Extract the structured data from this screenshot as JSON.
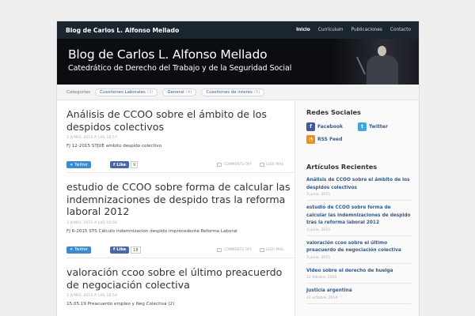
{
  "topnav": {
    "site_title": "Blog de Carlos L. Alfonso Mellado",
    "menu": [
      "Inicio",
      "Currículum",
      "Publicaciones",
      "Contacto"
    ]
  },
  "header": {
    "title": "Blog de Carlos L. Alfonso Mellado",
    "subtitle": "Catedrático de Derecho del Trabajo y de la Seguridad Social"
  },
  "categories": {
    "label": "Categorías",
    "items": [
      {
        "name": "Cuestiones Laborales",
        "count": "(3)"
      },
      {
        "name": "General",
        "count": "(4)"
      },
      {
        "name": "Cuestiones de interés",
        "count": "(5)"
      }
    ]
  },
  "posts": [
    {
      "title": "Análisis de CCOO sobre el ámbito de los despidos colectivos",
      "date": "3 JUNIO, 2015 A LAS 16:57",
      "excerpt": "FJ 12-2015 STJUE ambito despido colectivo",
      "twitter": "Twitter",
      "like": "Like",
      "like_count": "9",
      "comments": "COMMENTS OFF",
      "more": "LEER MAS"
    },
    {
      "title": "estudio de CCOO sobre forma de calcular las indemnizaciones de despido tras la reforma laboral 2012",
      "date": "3 JUNIO, 2015 A LAS 16:56",
      "excerpt": "FJ 6-2015 STS Cálculo indemnización despido improcedente Reforma Laboral",
      "twitter": "Twitter",
      "like": "Like",
      "like_count": "18",
      "comments": "COMMENTS OFF",
      "more": "LEER MAS"
    },
    {
      "title": "valoración ccoo sobre el último preacuerdo de negociación colectiva",
      "date": "3 JUNIO, 2015 A LAS 16:54",
      "excerpt": "15.05.19 Preacuerdo empleo y Neg Colectiva (2)"
    }
  ],
  "sidebar": {
    "social_title": "Redes Sociales",
    "social": [
      {
        "name": "Facebook",
        "icon": "facebook-icon"
      },
      {
        "name": "Twitter",
        "icon": "twitter-icon"
      },
      {
        "name": "RSS Feed",
        "icon": "rss-icon"
      }
    ],
    "recent_title": "Artículos Recientes",
    "recent": [
      {
        "title": "Análisis de CCOO sobre el ámbito de los despidos colectivos",
        "date": "3 junio, 2015"
      },
      {
        "title": "estudio de CCOO sobre forma de calcular las indemnizaciones de despido tras la reforma laboral 2012",
        "date": "3 junio, 2015"
      },
      {
        "title": "valoración ccoo sobre el último preacuerdo de negociación colectiva",
        "date": "3 junio, 2015"
      },
      {
        "title": "Video sobre el derecho de huelga",
        "date": "11 febrero, 2015"
      },
      {
        "title": "Justicia argentina",
        "date": "31 octubre, 2014"
      }
    ]
  },
  "colors": {
    "nav_bg": "#1b2530",
    "link": "#335a8a",
    "header_bg": "#0c0d10"
  }
}
